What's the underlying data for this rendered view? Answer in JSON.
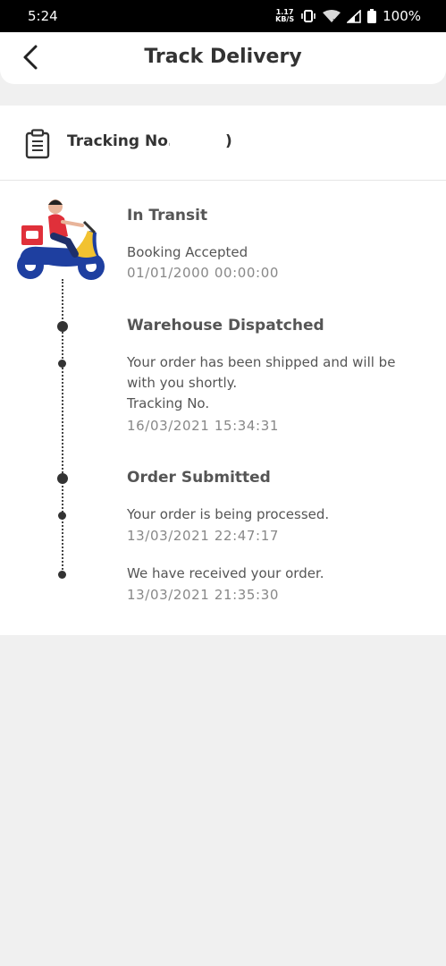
{
  "status_bar": {
    "time": "5:24",
    "net_speed_value": "1.17",
    "net_speed_unit": "KB/S",
    "battery": "100%"
  },
  "header": {
    "title": "Track Delivery",
    "back_icon": "chevron-left-icon"
  },
  "tracking": {
    "label": "Tracking No.",
    "suffix": ")",
    "icon": "clipboard-icon"
  },
  "timeline": {
    "in_transit": {
      "heading": "In Transit",
      "text": "Booking Accepted",
      "date": "01/01/2000 00:00:00"
    },
    "warehouse": {
      "heading": "Warehouse Dispatched",
      "text_line1": "Your order has been shipped and will be",
      "text_line2": "with you shortly.",
      "tracking_label": "Tracking No.",
      "date": "16/03/2021 15:34:31"
    },
    "order_submitted": {
      "heading": "Order Submitted",
      "text": "Your order is being processed.",
      "date": "13/03/2021 22:47:17"
    },
    "received": {
      "text": "We have received your order.",
      "date": "13/03/2021 21:35:30"
    }
  },
  "colors": {
    "scooter_blue": "#1e3fa0",
    "scooter_yellow": "#f2c230",
    "rider_red": "#e0303a"
  }
}
